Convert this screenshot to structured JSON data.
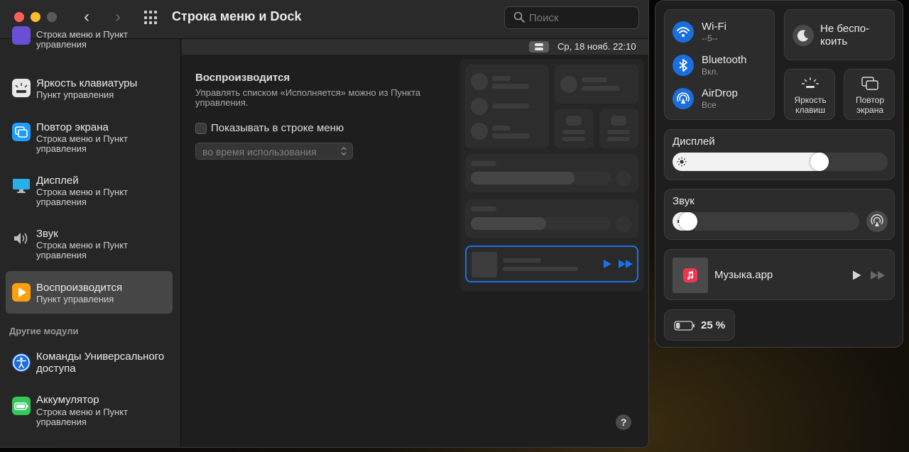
{
  "window": {
    "title": "Строка меню и Dock",
    "search_placeholder": "Поиск"
  },
  "sidebar": {
    "items": [
      {
        "title": "",
        "subtitle": "Строка меню и Пункт управления",
        "icon": "purple-partial-icon"
      },
      {
        "title": "Яркость клавиатуры",
        "subtitle": "Пункт управления",
        "icon": "keyboard-brightness-icon"
      },
      {
        "title": "Повтор экрана",
        "subtitle": "Строка меню и Пункт управления",
        "icon": "screen-mirroring-icon"
      },
      {
        "title": "Дисплей",
        "subtitle": "Строка меню и Пункт управления",
        "icon": "display-icon"
      },
      {
        "title": "Звук",
        "subtitle": "Строка меню и Пункт управления",
        "icon": "speaker-icon"
      },
      {
        "title": "Воспроизводится",
        "subtitle": "Пункт управления",
        "icon": "now-playing-icon",
        "active": true
      }
    ],
    "section_label": "Другие модули",
    "other_items": [
      {
        "title": "Команды Универсального доступа",
        "icon": "accessibility-icon"
      },
      {
        "title": "Аккумулятор",
        "subtitle": "Строка меню и Пункт управления",
        "icon": "battery-icon"
      }
    ]
  },
  "content": {
    "menubar_date": "Ср, 18 нояб.  22:10",
    "heading": "Воспроизводится",
    "description": "Управлять списком «Исполняется» можно из Пункта управления.",
    "checkbox_label": "Показывать в строке меню",
    "checkbox_checked": false,
    "popup_value": "во время использования",
    "help_label": "?"
  },
  "control_center": {
    "wifi": {
      "title": "Wi-Fi",
      "subtitle": "--5--"
    },
    "bluetooth": {
      "title": "Bluetooth",
      "subtitle": "Вкл."
    },
    "airdrop": {
      "title": "AirDrop",
      "subtitle": "Все"
    },
    "dnd": {
      "title_line1": "Не беспо-",
      "title_line2": "коить"
    },
    "keyboard_brightness": {
      "line1": "Яркость",
      "line2": "клавиш"
    },
    "screen_mirroring": {
      "line1": "Повтор",
      "line2": "экрана"
    },
    "display": {
      "title": "Дисплей",
      "level": 0.7
    },
    "sound": {
      "title": "Звук",
      "level": 0.04
    },
    "now_playing": {
      "app": "Музыка.app"
    },
    "battery": {
      "label": "25 %",
      "level": 0.25
    },
    "accent_color": "#1a6ee0"
  }
}
